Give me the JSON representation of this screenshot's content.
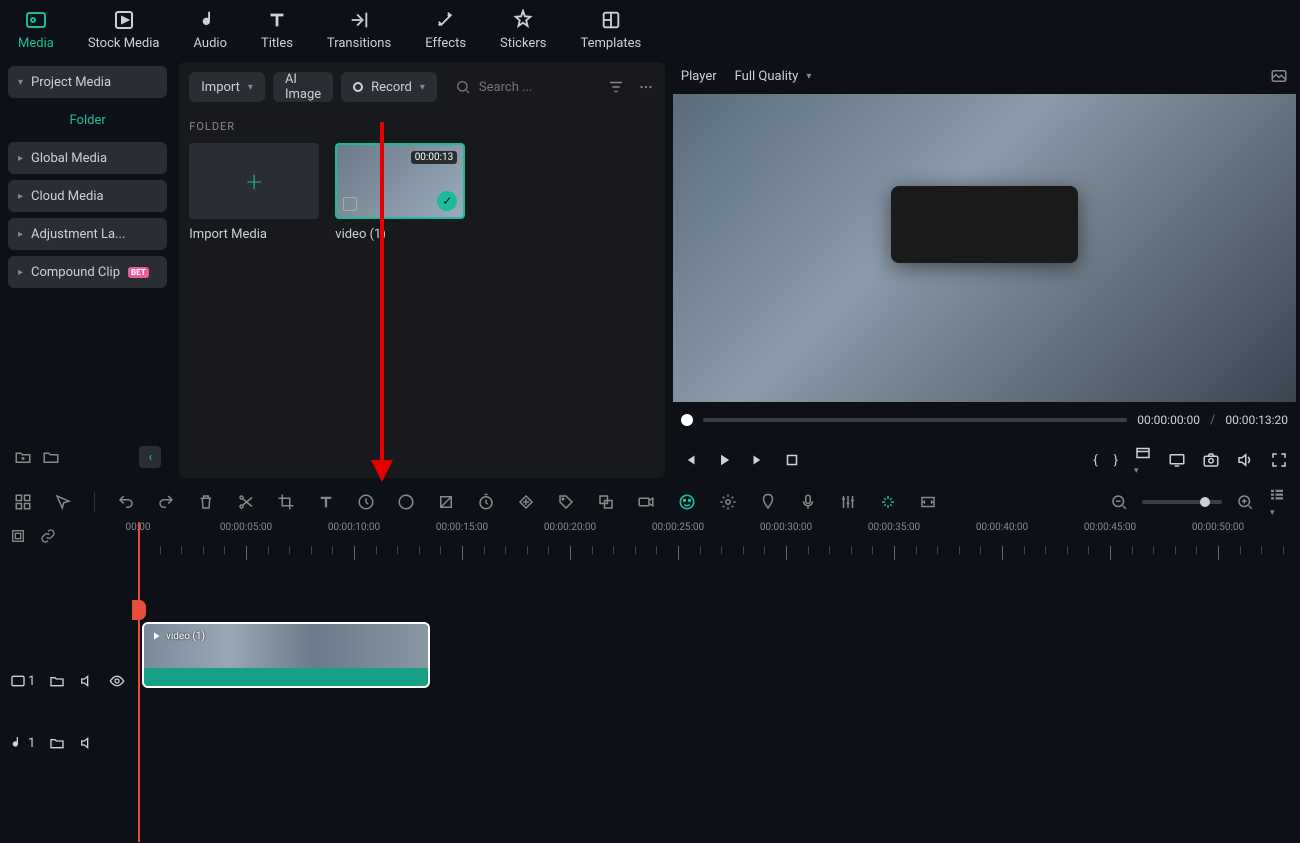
{
  "top_tabs": {
    "media": "Media",
    "stock": "Stock Media",
    "audio": "Audio",
    "titles": "Titles",
    "transitions": "Transitions",
    "effects": "Effects",
    "stickers": "Stickers",
    "templates": "Templates"
  },
  "sidebar": {
    "project_media": "Project Media",
    "folder_label": "Folder",
    "global_media": "Global Media",
    "cloud_media": "Cloud Media",
    "adjustment": "Adjustment La...",
    "compound": "Compound Clip",
    "compound_badge": "BET"
  },
  "media_bar": {
    "import": "Import",
    "ai_image": "AI Image",
    "record": "Record",
    "search_placeholder": "Search ..."
  },
  "media_panel": {
    "folder_label": "FOLDER",
    "import_tile": "Import Media",
    "clip_name": "video (1)",
    "clip_duration": "00:00:13"
  },
  "player": {
    "title": "Player",
    "quality": "Full Quality",
    "current": "00:00:00:00",
    "sep": "/",
    "total": "00:00:13:20"
  },
  "timeline": {
    "ruler": [
      "00:00",
      "00:00:05:00",
      "00:00:10:00",
      "00:00:15:00",
      "00:00:20:00",
      "00:00:25:00",
      "00:00:30:00",
      "00:00:35:00",
      "00:00:40:00",
      "00:00:45:00",
      "00:00:50:00"
    ],
    "video_track_num": "1",
    "audio_track_num": "1",
    "clip_label": "video (1)"
  }
}
